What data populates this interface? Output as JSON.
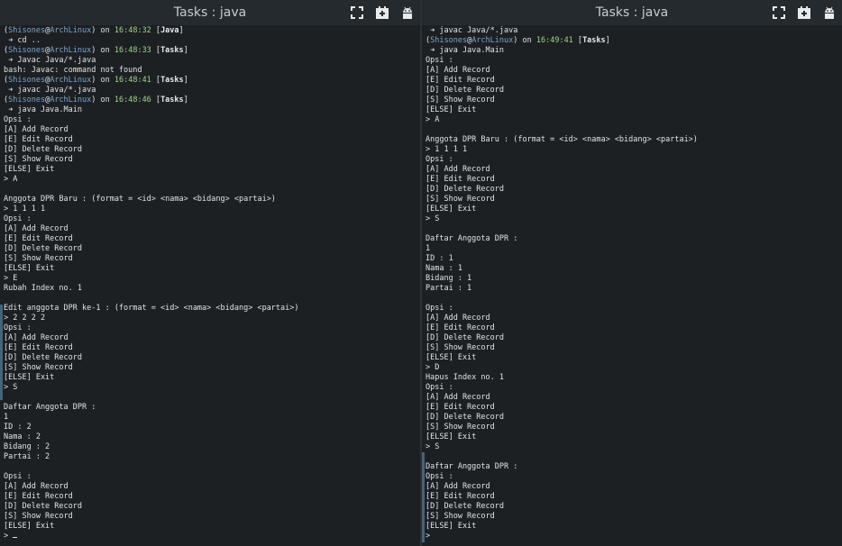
{
  "left_window": {
    "title": "Tasks : java",
    "controls": [
      "fullscreen-icon",
      "add-icon",
      "android-icon"
    ],
    "lines": [
      {
        "type": "prompt",
        "user": "Shisones",
        "host": "ArchLinux",
        "time": "16:48:32",
        "dir": "Java"
      },
      {
        "type": "cmd",
        "text": "cd .."
      },
      {
        "type": "prompt",
        "user": "Shisones",
        "host": "ArchLinux",
        "time": "16:48:33",
        "dir": "Tasks"
      },
      {
        "type": "cmd",
        "text": "Javac Java/*.java"
      },
      {
        "type": "text",
        "text": "bash: Javac: command not found"
      },
      {
        "type": "prompt",
        "user": "Shisones",
        "host": "ArchLinux",
        "time": "16:48:41",
        "dir": "Tasks"
      },
      {
        "type": "cmd",
        "text": "javac Java/*.java"
      },
      {
        "type": "prompt",
        "user": "Shisones",
        "host": "ArchLinux",
        "time": "16:48:46",
        "dir": "Tasks"
      },
      {
        "type": "cmd",
        "text": "java Java.Main"
      },
      {
        "type": "text",
        "text": "Opsi :"
      },
      {
        "type": "text",
        "text": "[A] Add Record"
      },
      {
        "type": "text",
        "text": "[E] Edit Record"
      },
      {
        "type": "text",
        "text": "[D] Delete Record"
      },
      {
        "type": "text",
        "text": "[S] Show Record"
      },
      {
        "type": "text",
        "text": "[ELSE] Exit"
      },
      {
        "type": "text",
        "text": "> A"
      },
      {
        "type": "text",
        "text": ""
      },
      {
        "type": "text",
        "text": "Anggota DPR Baru : (format = <id> <nama> <bidang> <partai>)"
      },
      {
        "type": "text",
        "text": "> 1 1 1 1"
      },
      {
        "type": "text",
        "text": "Opsi :"
      },
      {
        "type": "text",
        "text": "[A] Add Record"
      },
      {
        "type": "text",
        "text": "[E] Edit Record"
      },
      {
        "type": "text",
        "text": "[D] Delete Record"
      },
      {
        "type": "text",
        "text": "[S] Show Record"
      },
      {
        "type": "text",
        "text": "[ELSE] Exit"
      },
      {
        "type": "text",
        "text": "> E"
      },
      {
        "type": "text",
        "text": "Rubah Index no. 1"
      },
      {
        "type": "text",
        "text": ""
      },
      {
        "type": "text",
        "text": "Edit anggota DPR ke-1 : (format = <id> <nama> <bidang> <partai>)"
      },
      {
        "type": "text",
        "text": "> 2 2 2 2"
      },
      {
        "type": "text",
        "text": "Opsi :"
      },
      {
        "type": "text",
        "text": "[A] Add Record"
      },
      {
        "type": "text",
        "text": "[E] Edit Record"
      },
      {
        "type": "text",
        "text": "[D] Delete Record"
      },
      {
        "type": "text",
        "text": "[S] Show Record"
      },
      {
        "type": "text",
        "text": "[ELSE] Exit"
      },
      {
        "type": "text",
        "text": "> S"
      },
      {
        "type": "text",
        "text": ""
      },
      {
        "type": "text",
        "text": "Daftar Anggota DPR :"
      },
      {
        "type": "text",
        "text": "1"
      },
      {
        "type": "text",
        "text": "ID : 2"
      },
      {
        "type": "text",
        "text": "Nama : 2"
      },
      {
        "type": "text",
        "text": "Bidang : 2"
      },
      {
        "type": "text",
        "text": "Partai : 2"
      },
      {
        "type": "text",
        "text": ""
      },
      {
        "type": "text",
        "text": "Opsi :"
      },
      {
        "type": "text",
        "text": "[A] Add Record"
      },
      {
        "type": "text",
        "text": "[E] Edit Record"
      },
      {
        "type": "text",
        "text": "[D] Delete Record"
      },
      {
        "type": "text",
        "text": "[S] Show Record"
      },
      {
        "type": "text",
        "text": "[ELSE] Exit"
      },
      {
        "type": "input",
        "text": "> "
      }
    ]
  },
  "right_window": {
    "title": "Tasks : java",
    "controls": [
      "fullscreen-icon",
      "add-icon",
      "android-icon"
    ],
    "lines": [
      {
        "type": "cmd",
        "text": "javac Java/*.java"
      },
      {
        "type": "prompt",
        "user": "Shisones",
        "host": "ArchLinux",
        "time": "16:49:41",
        "dir": "Tasks"
      },
      {
        "type": "cmd",
        "text": "java Java.Main"
      },
      {
        "type": "text",
        "text": "Opsi :"
      },
      {
        "type": "text",
        "text": "[A] Add Record"
      },
      {
        "type": "text",
        "text": "[E] Edit Record"
      },
      {
        "type": "text",
        "text": "[D] Delete Record"
      },
      {
        "type": "text",
        "text": "[S] Show Record"
      },
      {
        "type": "text",
        "text": "[ELSE] Exit"
      },
      {
        "type": "text",
        "text": "> A"
      },
      {
        "type": "text",
        "text": ""
      },
      {
        "type": "text",
        "text": "Anggota DPR Baru : (format = <id> <nama> <bidang> <partai>)"
      },
      {
        "type": "text",
        "text": "> 1 1 1 1"
      },
      {
        "type": "text",
        "text": "Opsi :"
      },
      {
        "type": "text",
        "text": "[A] Add Record"
      },
      {
        "type": "text",
        "text": "[E] Edit Record"
      },
      {
        "type": "text",
        "text": "[D] Delete Record"
      },
      {
        "type": "text",
        "text": "[S] Show Record"
      },
      {
        "type": "text",
        "text": "[ELSE] Exit"
      },
      {
        "type": "text",
        "text": "> S"
      },
      {
        "type": "text",
        "text": ""
      },
      {
        "type": "text",
        "text": "Daftar Anggota DPR :"
      },
      {
        "type": "text",
        "text": "1"
      },
      {
        "type": "text",
        "text": "ID : 1"
      },
      {
        "type": "text",
        "text": "Nama : 1"
      },
      {
        "type": "text",
        "text": "Bidang : 1"
      },
      {
        "type": "text",
        "text": "Partai : 1"
      },
      {
        "type": "text",
        "text": ""
      },
      {
        "type": "text",
        "text": "Opsi :"
      },
      {
        "type": "text",
        "text": "[A] Add Record"
      },
      {
        "type": "text",
        "text": "[E] Edit Record"
      },
      {
        "type": "text",
        "text": "[D] Delete Record"
      },
      {
        "type": "text",
        "text": "[S] Show Record"
      },
      {
        "type": "text",
        "text": "[ELSE] Exit"
      },
      {
        "type": "text",
        "text": "> D"
      },
      {
        "type": "text",
        "text": "Hapus Index no. 1"
      },
      {
        "type": "text",
        "text": "Opsi :"
      },
      {
        "type": "text",
        "text": "[A] Add Record"
      },
      {
        "type": "text",
        "text": "[E] Edit Record"
      },
      {
        "type": "text",
        "text": "[D] Delete Record"
      },
      {
        "type": "text",
        "text": "[S] Show Record"
      },
      {
        "type": "text",
        "text": "[ELSE] Exit"
      },
      {
        "type": "text",
        "text": "> S"
      },
      {
        "type": "text",
        "text": ""
      },
      {
        "type": "text",
        "text": "Daftar Anggota DPR :"
      },
      {
        "type": "text",
        "text": "Opsi :"
      },
      {
        "type": "text",
        "text": "[A] Add Record"
      },
      {
        "type": "text",
        "text": "[E] Edit Record"
      },
      {
        "type": "text",
        "text": "[D] Delete Record"
      },
      {
        "type": "text",
        "text": "[S] Show Record"
      },
      {
        "type": "text",
        "text": "[ELSE] Exit"
      },
      {
        "type": "input",
        "text": ">"
      }
    ]
  },
  "colors": {
    "background": "#1c2023",
    "titlebar": "#252a2e",
    "text": "#e2e4e6",
    "user_host": "#7aa6cf",
    "time": "#9fd58a",
    "scroll_marker": "#46637e"
  }
}
